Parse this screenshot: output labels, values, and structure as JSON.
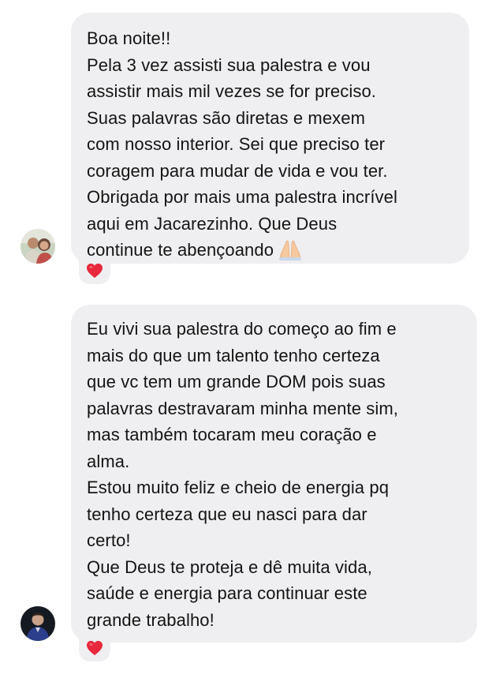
{
  "messages": [
    {
      "lines": [
        "Boa noite!!",
        "Pela 3 vez assisti sua palestra e vou",
        "assistir mais mil vezes se for preciso.",
        "Suas palavras são diretas e mexem",
        "com nosso interior. Sei que preciso ter",
        "coragem para mudar de vida e vou ter.",
        "Obrigada por mais uma palestra incrível",
        "aqui em Jacarezinho. Que Deus",
        "continue te abençoando"
      ],
      "trailing_emoji": "praying-hands-icon",
      "reaction": "heart-icon"
    },
    {
      "lines": [
        "Eu vivi sua palestra do começo ao fim e",
        "mais do que um talento tenho certeza",
        "que vc tem um grande DOM pois suas",
        "palavras destravaram minha mente sim,",
        "mas também tocaram meu coração e",
        "alma.",
        "Estou muito feliz e cheio de energia pq",
        "tenho certeza que eu nasci para dar",
        "certo!",
        "Que Deus te proteja e dê muita vida,",
        "saúde e energia para continuar este",
        "grande trabalho!"
      ],
      "reaction": "heart-icon"
    }
  ],
  "colors": {
    "bubble": "#efeff1",
    "text": "#141414",
    "heart": "#e8283c"
  }
}
